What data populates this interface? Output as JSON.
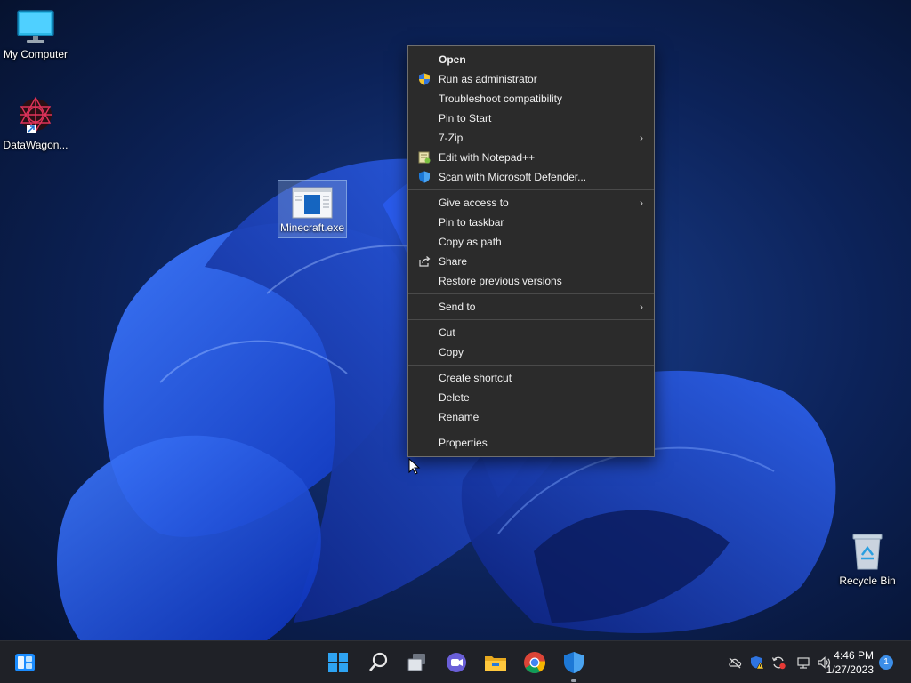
{
  "desktop": {
    "icons": [
      {
        "label": "My Computer",
        "icon": "monitor-icon"
      },
      {
        "label": "DataWagon...",
        "icon": "datawagon-app-icon"
      },
      {
        "label": "Minecraft.exe",
        "icon": "exe-file-icon"
      },
      {
        "label": "Recycle Bin",
        "icon": "recycle-bin-icon"
      }
    ]
  },
  "context_menu": {
    "items": [
      {
        "label": "Open"
      },
      {
        "label": "Run as administrator",
        "icon": "uac-shield-icon"
      },
      {
        "label": "Troubleshoot compatibility"
      },
      {
        "label": "Pin to Start"
      },
      {
        "label": "7-Zip",
        "submenu": true
      },
      {
        "label": "Edit with Notepad++",
        "icon": "notepad-plus-plus-icon"
      },
      {
        "label": "Scan with Microsoft Defender...",
        "icon": "defender-shield-icon"
      },
      {
        "label": "Give access to",
        "submenu": true
      },
      {
        "label": "Pin to taskbar"
      },
      {
        "label": "Copy as path"
      },
      {
        "label": "Share",
        "icon": "share-icon"
      },
      {
        "label": "Restore previous versions"
      },
      {
        "label": "Send to",
        "submenu": true
      },
      {
        "label": "Cut"
      },
      {
        "label": "Copy"
      },
      {
        "label": "Create shortcut"
      },
      {
        "label": "Delete"
      },
      {
        "label": "Rename"
      },
      {
        "label": "Properties"
      }
    ],
    "chevron": "›"
  },
  "taskbar": {
    "buttons": [
      "widgets-icon",
      "start-icon",
      "search-icon",
      "task-view-icon",
      "teams-chat-icon",
      "file-explorer-icon",
      "chrome-icon",
      "defender-icon"
    ],
    "tray": [
      "onedrive-offline-icon",
      "security-warning-icon",
      "sync-error-icon",
      "network-icon",
      "volume-icon"
    ],
    "clock": {
      "time": "4:46 PM",
      "date": "1/27/2023"
    },
    "notification_count": "1"
  },
  "colors": {
    "menu_bg": "#2b2b2b",
    "taskbar_bg": "#1f2127",
    "accent": "#3c8ee8"
  }
}
